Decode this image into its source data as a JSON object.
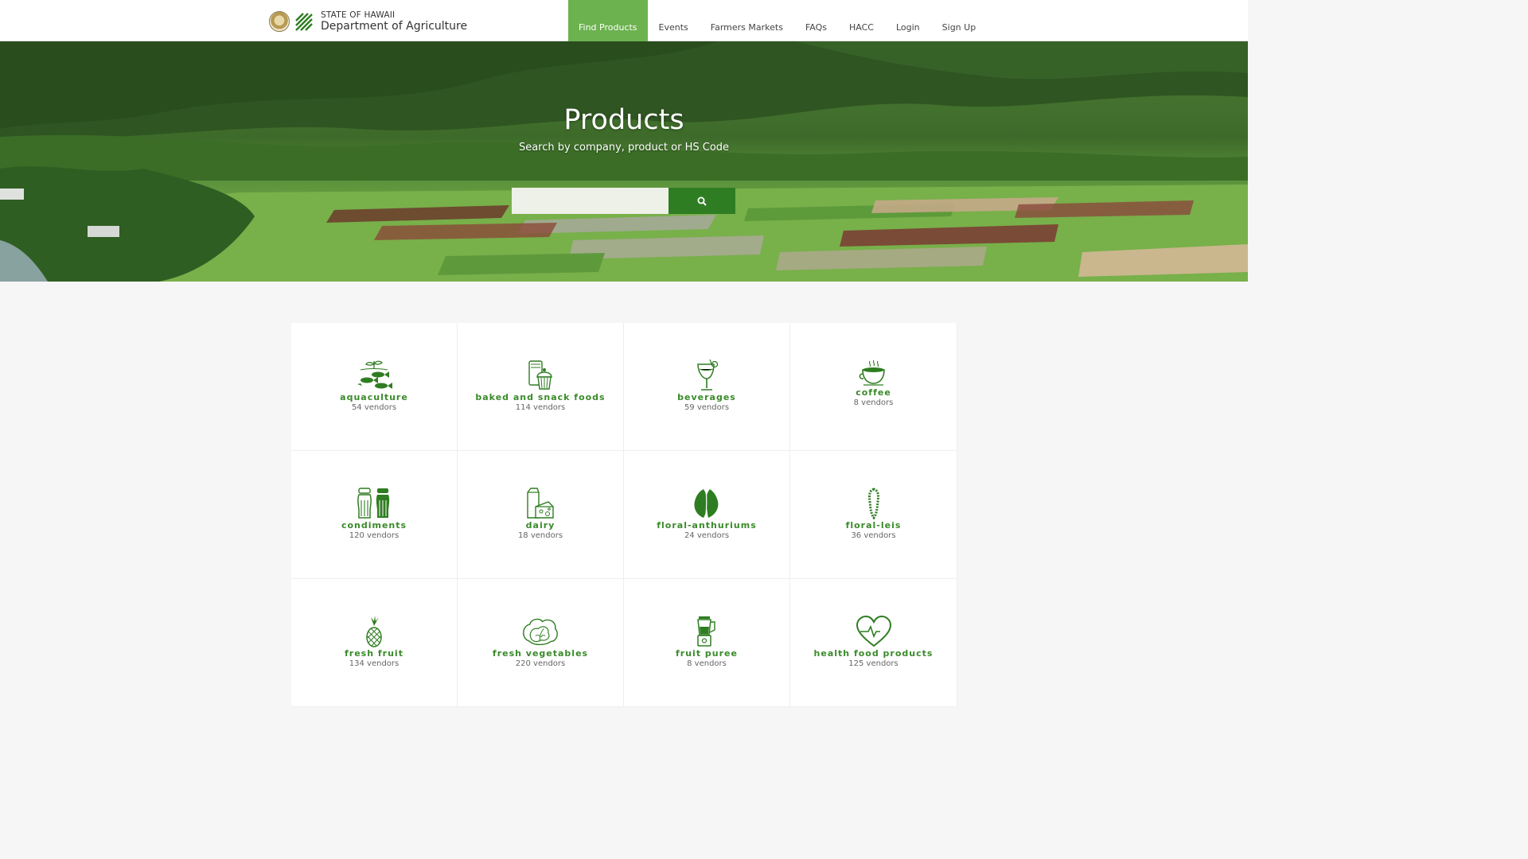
{
  "brand": {
    "top_line": "STATE OF HAWAII",
    "main_line": "Department of Agriculture"
  },
  "nav": [
    {
      "label": "Find Products",
      "active": true
    },
    {
      "label": "Events"
    },
    {
      "label": "Farmers Markets"
    },
    {
      "label": "FAQs"
    },
    {
      "label": "HACC"
    },
    {
      "label": "Login"
    },
    {
      "label": "Sign Up"
    }
  ],
  "hero": {
    "title": "Products",
    "subtitle": "Search by company, product or HS Code",
    "search_value": "",
    "search_button_icon": "search-icon"
  },
  "categories": [
    {
      "name": "aquaculture",
      "count": "54 vendors",
      "icon": "aquaculture-icon"
    },
    {
      "name": "baked and snack foods",
      "count": "114 vendors",
      "icon": "baked-goods-icon"
    },
    {
      "name": "beverages",
      "count": "59 vendors",
      "icon": "cocktail-glass-icon"
    },
    {
      "name": "coffee",
      "count": "8 vendors",
      "icon": "coffee-cup-icon"
    },
    {
      "name": "condiments",
      "count": "120 vendors",
      "icon": "salt-pepper-shakers-icon"
    },
    {
      "name": "dairy",
      "count": "18 vendors",
      "icon": "milk-cheese-icon"
    },
    {
      "name": "floral-anthuriums",
      "count": "24 vendors",
      "icon": "anthurium-icon"
    },
    {
      "name": "floral-leis",
      "count": "36 vendors",
      "icon": "lei-icon"
    },
    {
      "name": "fresh fruit",
      "count": "134 vendors",
      "icon": "pineapple-icon"
    },
    {
      "name": "fresh vegetables",
      "count": "220 vendors",
      "icon": "cabbage-icon"
    },
    {
      "name": "fruit puree",
      "count": "8 vendors",
      "icon": "blender-icon"
    },
    {
      "name": "health food products",
      "count": "125 vendors",
      "icon": "heart-icon"
    }
  ],
  "colors": {
    "accent_green": "#6cb24f",
    "button_green": "#2f7d22",
    "category_text": "#3a8a2a"
  }
}
